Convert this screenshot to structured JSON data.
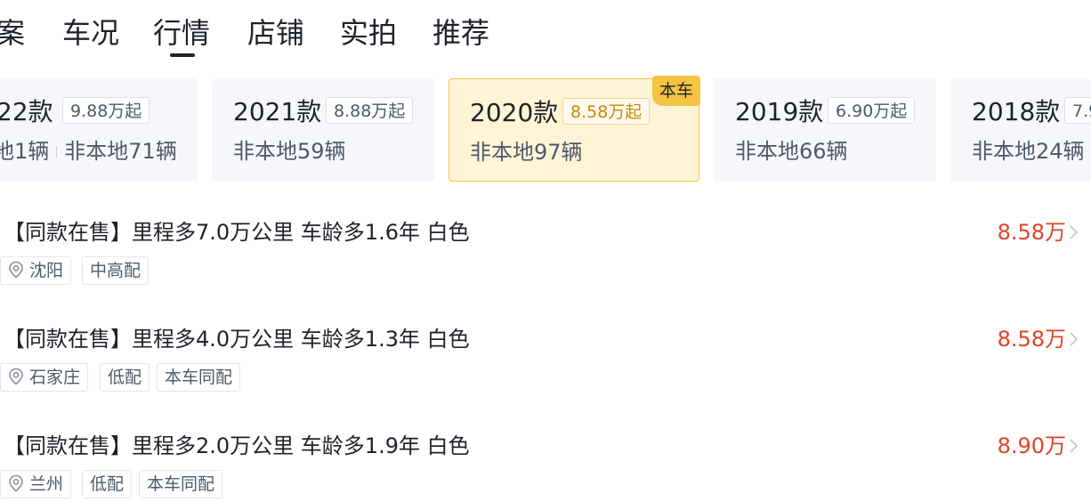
{
  "tabs": [
    {
      "label": "案"
    },
    {
      "label": "车况"
    },
    {
      "label": "行情",
      "active": true
    },
    {
      "label": "店铺"
    },
    {
      "label": "实拍"
    },
    {
      "label": "推荐"
    }
  ],
  "year_cards": [
    {
      "year": "22款",
      "price": "9.88万起",
      "count_local": "地1辆",
      "count_nonlocal": "非本地71辆"
    },
    {
      "year": "2021款",
      "price": "8.88万起",
      "count_nonlocal": "非本地59辆"
    },
    {
      "year": "2020款",
      "price": "8.58万起",
      "count_nonlocal": "非本地97辆",
      "selected": true,
      "badge": "本车"
    },
    {
      "year": "2019款",
      "price": "6.90万起",
      "count_nonlocal": "非本地66辆"
    },
    {
      "year": "2018款",
      "price": "7.9",
      "count_nonlocal": "非本地24辆"
    }
  ],
  "listings": [
    {
      "title": "【同款在售】里程多7.0万公里 车龄多1.6年 白色",
      "price": "8.58万",
      "city": "沈阳",
      "tags": [
        "中高配"
      ]
    },
    {
      "title": "【同款在售】里程多4.0万公里 车龄多1.3年 白色",
      "price": "8.58万",
      "city": "石家庄",
      "tags": [
        "低配",
        "本车同配"
      ]
    },
    {
      "title": "【同款在售】里程多2.0万公里 车龄多1.9年 白色",
      "price": "8.90万",
      "city": "兰州",
      "tags": [
        "低配",
        "本车同配"
      ]
    }
  ],
  "colors": {
    "price_red": "#e04427",
    "selected_bg": "#fff4d6",
    "badge_yellow": "#f5c443"
  }
}
